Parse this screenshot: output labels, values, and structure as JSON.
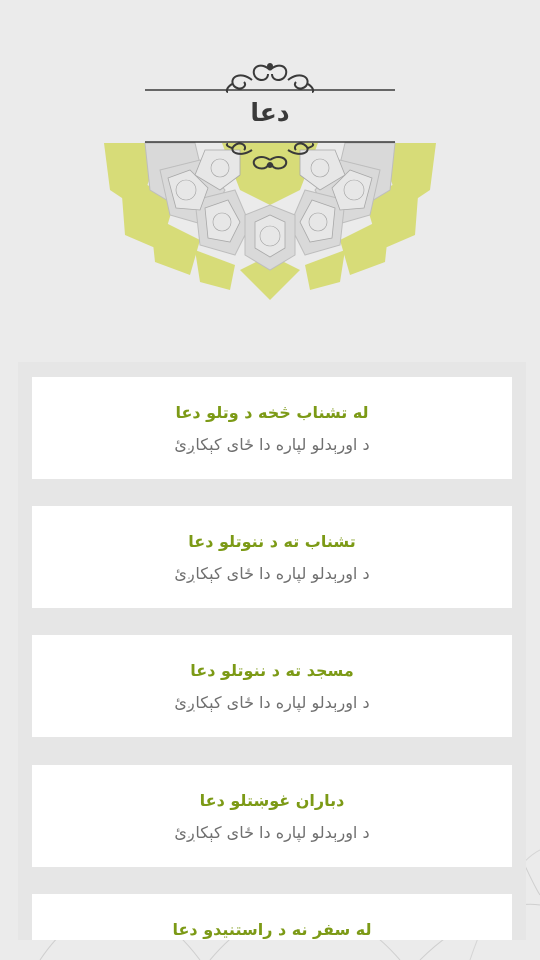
{
  "header": {
    "title": "دعا"
  },
  "items": [
    {
      "title": "له تشناب څخه د وتلو دعا",
      "subtitle": "د اورېدلو لپاره دا ځای کېکاږئ"
    },
    {
      "title": "تشناب ته د ننوتلو دعا",
      "subtitle": "د اورېدلو لپاره دا ځای کېکاږئ"
    },
    {
      "title": "مسجد ته د ننوتلو  دعا",
      "subtitle": "د اورېدلو لپاره دا ځای کېکاږئ"
    },
    {
      "title": "دباران غوښتلو دعا",
      "subtitle": "د اورېدلو لپاره دا ځای کېکاږئ"
    },
    {
      "title": "له سفر نه د راستنیدو  دعا",
      "subtitle": ""
    }
  ],
  "colors": {
    "accent": "#7c9a16",
    "mandala_yellow": "#d7dc78",
    "background": "#ebebeb"
  }
}
